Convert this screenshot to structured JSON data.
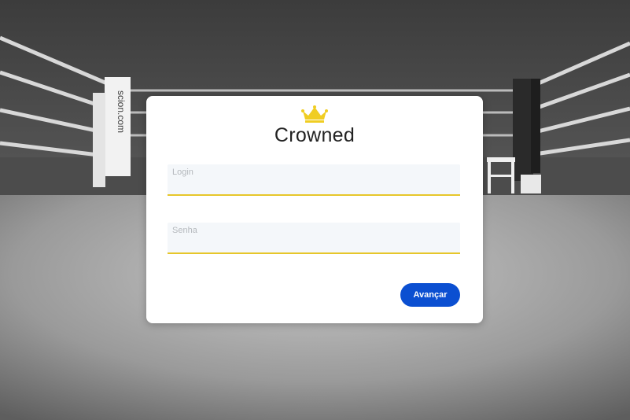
{
  "app": {
    "brand_name": "Crowned",
    "logo_icon": "crown-icon",
    "accent_color": "#e6c62a",
    "primary_color": "#0b4fd1"
  },
  "background": {
    "description_icon": "boxing-ring-photo",
    "ring_post_left_text": "scion.com"
  },
  "form": {
    "login": {
      "label": "Login",
      "value": ""
    },
    "senha": {
      "label": "Senha",
      "value": ""
    },
    "submit_label": "Avançar"
  }
}
